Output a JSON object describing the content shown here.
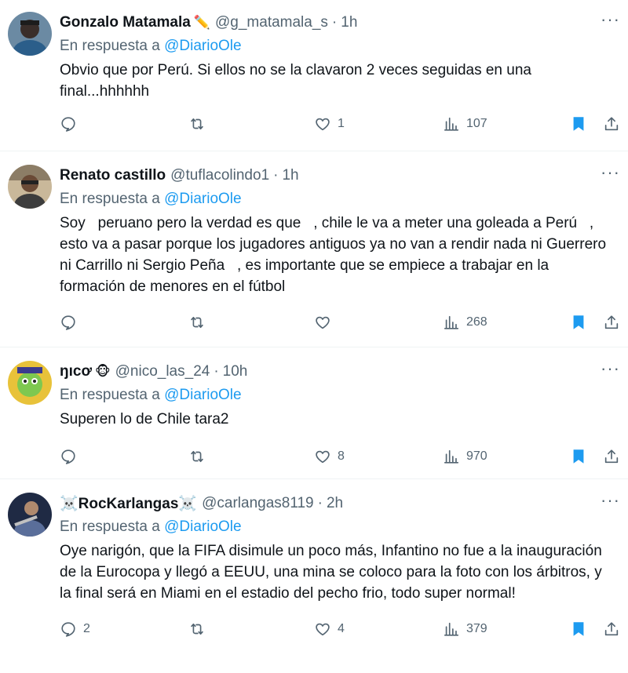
{
  "tweets": [
    {
      "name": "Gonzalo Matamala",
      "emoji": "✏️",
      "handle": "@g_matamala_s",
      "time": "1h",
      "reply_prefix": "En respuesta a ",
      "reply_to": "@DiarioOle",
      "text": "Obvio que por Perú. Si ellos no se la clavaron 2 veces seguidas en una final...hhhhhh",
      "replies": "",
      "retweets": "",
      "likes": "1",
      "views": "107",
      "more": "···"
    },
    {
      "name": "Renato castillo",
      "emoji": "",
      "handle": "@tuflacolindo1",
      "time": "1h",
      "reply_prefix": "En respuesta a ",
      "reply_to": "@DiarioOle",
      "text": "Soy   peruano pero la verdad es que   , chile le va a meter una goleada a Perú   , esto va a pasar porque los jugadores antiguos ya no van a rendir nada ni Guerrero ni Carrillo ni Sergio Peña   , es importante que se empiece a trabajar en la formación de menores en el fútbol",
      "replies": "",
      "retweets": "",
      "likes": "",
      "views": "268",
      "more": "···"
    },
    {
      "name": "ŋıcơ",
      "emoji": "🐵",
      "handle": "@nico_las_24",
      "time": "10h",
      "reply_prefix": "En respuesta a ",
      "reply_to": "@DiarioOle",
      "text": "Superen lo de Chile tara2",
      "replies": "",
      "retweets": "",
      "likes": "8",
      "views": "970",
      "more": "···"
    },
    {
      "name": "☠️RocKarlangas☠️",
      "emoji": "",
      "handle": "@carlangas8119",
      "time": "2h",
      "reply_prefix": "En respuesta a ",
      "reply_to": "@DiarioOle",
      "text": "Oye narigón, que la FIFA disimule un poco más, Infantino no fue a la inauguración de la Eurocopa y llegó a EEUU, una mina se coloco para la foto con los árbitros, y la final será en Miami en el estadio del pecho frio, todo super normal!",
      "replies": "2",
      "retweets": "",
      "likes": "4",
      "views": "379",
      "more": "···"
    }
  ],
  "icons": {
    "reply": "reply-icon",
    "retweet": "retweet-icon",
    "like": "heart-icon",
    "views": "views-icon",
    "bookmark": "bookmark-icon",
    "share": "share-icon",
    "more": "more-icon"
  },
  "colors": {
    "link": "#1d9bf0",
    "muted": "#536471",
    "text": "#0f1419",
    "bookmark": "#1d9bf0"
  }
}
